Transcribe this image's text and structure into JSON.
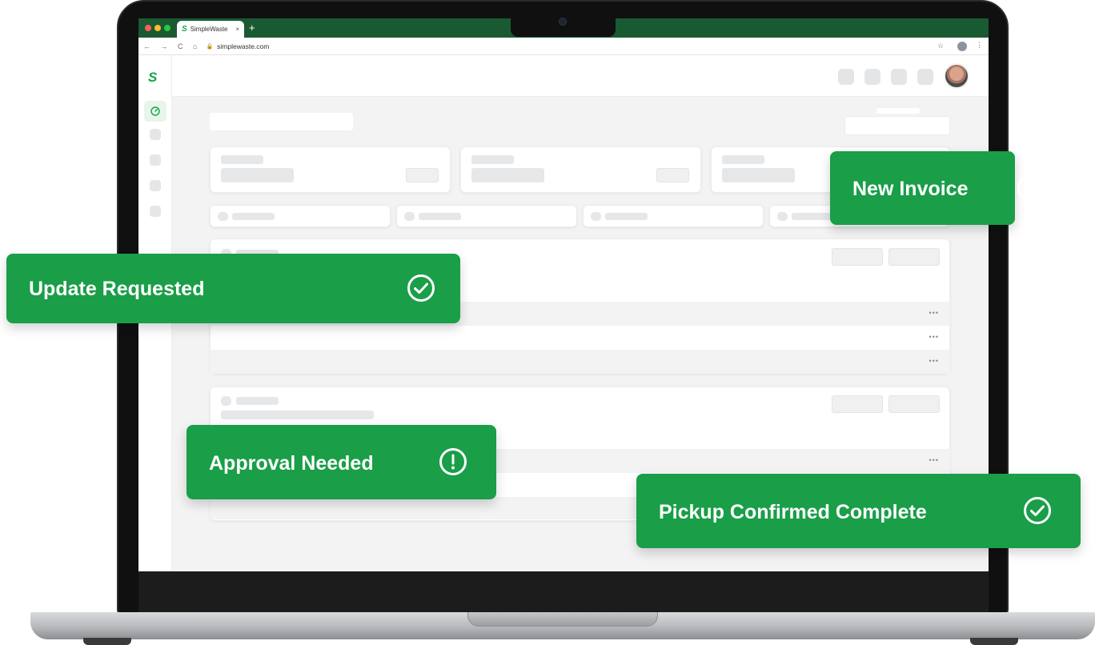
{
  "browser": {
    "tab_icon": "S",
    "tab_title": "SimpleWaste",
    "tab_close": "×",
    "new_tab": "+",
    "nav_glyphs": "← → C ⌂",
    "url": "simplewaste.com",
    "lock_glyph": "🔒",
    "star_glyph": "☆",
    "menu_glyph": "⋮"
  },
  "app": {
    "logo_text": "S",
    "accent": "#16a34a"
  },
  "table": {
    "row_menu": "•••"
  },
  "toasts": {
    "new_invoice": {
      "label": "New Invoice",
      "icon": "exclamation-circle-icon"
    },
    "update_requested": {
      "label": "Update Requested",
      "icon": "check-circle-icon"
    },
    "approval_needed": {
      "label": "Approval Needed",
      "icon": "exclamation-circle-icon"
    },
    "pickup_confirmed": {
      "label": "Pickup Confirmed Complete",
      "icon": "check-circle-icon"
    }
  }
}
